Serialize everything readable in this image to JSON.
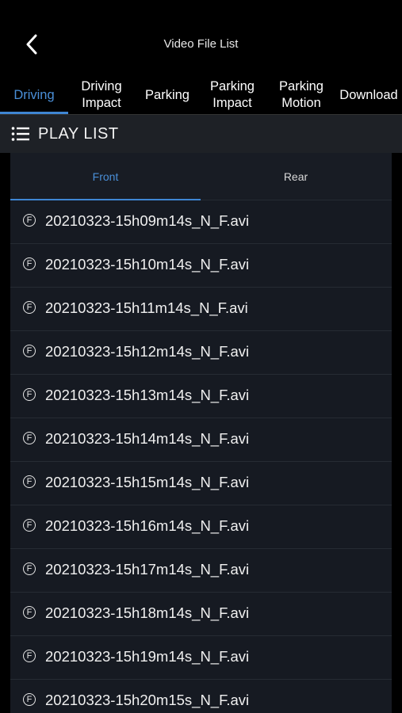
{
  "header": {
    "title": "Video File List",
    "back_icon": "chevron-left-icon"
  },
  "tabs": [
    {
      "label": "Driving",
      "active": true
    },
    {
      "label": "Driving Impact",
      "active": false
    },
    {
      "label": "Parking",
      "active": false
    },
    {
      "label": "Parking Impact",
      "active": false
    },
    {
      "label": "Parking Motion",
      "active": false
    },
    {
      "label": "Download",
      "active": false
    }
  ],
  "playlist": {
    "title": "PLAY LIST",
    "icon": "list-icon"
  },
  "subtabs": [
    {
      "label": "Front",
      "active": true
    },
    {
      "label": "Rear",
      "active": false
    }
  ],
  "files": [
    {
      "badge": "F",
      "name": "20210323-15h09m14s_N_F.avi"
    },
    {
      "badge": "F",
      "name": "20210323-15h10m14s_N_F.avi"
    },
    {
      "badge": "F",
      "name": "20210323-15h11m14s_N_F.avi"
    },
    {
      "badge": "F",
      "name": "20210323-15h12m14s_N_F.avi"
    },
    {
      "badge": "F",
      "name": "20210323-15h13m14s_N_F.avi"
    },
    {
      "badge": "F",
      "name": "20210323-15h14m14s_N_F.avi"
    },
    {
      "badge": "F",
      "name": "20210323-15h15m14s_N_F.avi"
    },
    {
      "badge": "F",
      "name": "20210323-15h16m14s_N_F.avi"
    },
    {
      "badge": "F",
      "name": "20210323-15h17m14s_N_F.avi"
    },
    {
      "badge": "F",
      "name": "20210323-15h18m14s_N_F.avi"
    },
    {
      "badge": "F",
      "name": "20210323-15h19m14s_N_F.avi"
    },
    {
      "badge": "F",
      "name": "20210323-15h20m15s_N_F.avi"
    }
  ],
  "colors": {
    "accent": "#3f86d4",
    "background": "#000000",
    "panel": "#161a22"
  }
}
